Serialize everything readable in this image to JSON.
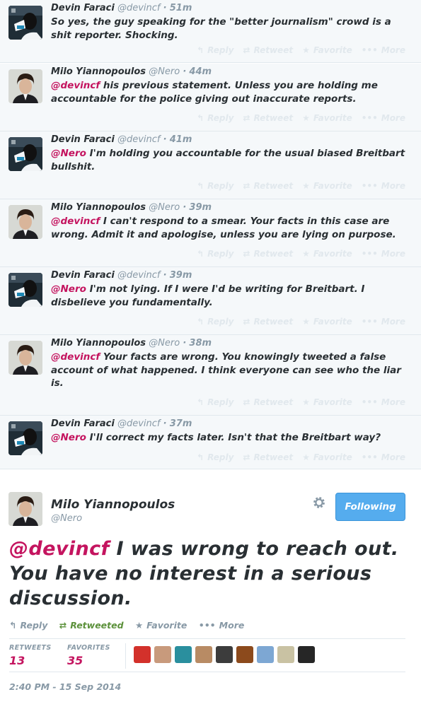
{
  "action_labels": {
    "reply": "Reply",
    "retweet": "Retweet",
    "favorite": "Favorite",
    "more": "More"
  },
  "action_icons": {
    "reply": "↰",
    "retweet": "⇄",
    "favorite": "★",
    "more": "•••"
  },
  "tweets": [
    {
      "author": "devin",
      "name": "Devin Faraci",
      "handle": "@devincf",
      "sep": "·",
      "time": "51m",
      "mention": "",
      "text": "So yes, the guy speaking for the \"better journalism\" crowd is a shit reporter. Shocking."
    },
    {
      "author": "milo",
      "name": "Milo Yiannopoulos",
      "handle": "@Nero",
      "sep": "·",
      "time": "44m",
      "mention": "@devincf",
      "text": " his previous statement. Unless you are holding me accountable for the police giving out inaccurate reports."
    },
    {
      "author": "devin",
      "name": "Devin Faraci",
      "handle": "@devincf",
      "sep": "·",
      "time": "41m",
      "mention": "@Nero",
      "text": " I'm holding you accountable for the usual biased Breitbart bullshit."
    },
    {
      "author": "milo",
      "name": "Milo Yiannopoulos",
      "handle": "@Nero",
      "sep": "·",
      "time": "39m",
      "mention": "@devincf",
      "text": " I can't respond to a smear. Your facts in this case are wrong. Admit it and apologise, unless you are lying on purpose."
    },
    {
      "author": "devin",
      "name": "Devin Faraci",
      "handle": "@devincf",
      "sep": "·",
      "time": "39m",
      "mention": "@Nero",
      "text": " I'm not lying. If I were I'd be writing for Breitbart. I disbelieve you fundamentally."
    },
    {
      "author": "milo",
      "name": "Milo Yiannopoulos",
      "handle": "@Nero",
      "sep": "·",
      "time": "38m",
      "mention": "@devincf",
      "text": " Your facts are wrong. You knowingly tweeted a false account of what happened. I think everyone can see who the liar is."
    },
    {
      "author": "devin",
      "name": "Devin Faraci",
      "handle": "@devincf",
      "sep": "·",
      "time": "37m",
      "mention": "@Nero",
      "text": " I'll correct my facts later. Isn't that the Breitbart way?"
    }
  ],
  "main_tweet": {
    "name": "Milo Yiannopoulos",
    "handle": "@Nero",
    "follow_label": "Following",
    "mention": "@devincf",
    "text": " I was wrong to reach out. You have no interest in a serious discussion.",
    "actions": {
      "reply": "Reply",
      "retweet": "Retweeted",
      "favorite": "Favorite",
      "more": "More"
    },
    "retweets_label": "RETWEETS",
    "retweets_count": "13",
    "favorites_label": "FAVORITES",
    "favorites_count": "35",
    "date": "2:40 PM - 15 Sep 2014",
    "fav_avatar_colors": [
      "#d3312b",
      "#c89a7c",
      "#2a8f9e",
      "#b88b64",
      "#3c3c3c",
      "#8c4a1c",
      "#7da7d3",
      "#c9c2a3",
      "#262626"
    ]
  },
  "colors": {
    "mention": "#c4145f",
    "follow_bg": "#55acee",
    "retweeted": "#5c913b",
    "muted": "#8899a6"
  }
}
